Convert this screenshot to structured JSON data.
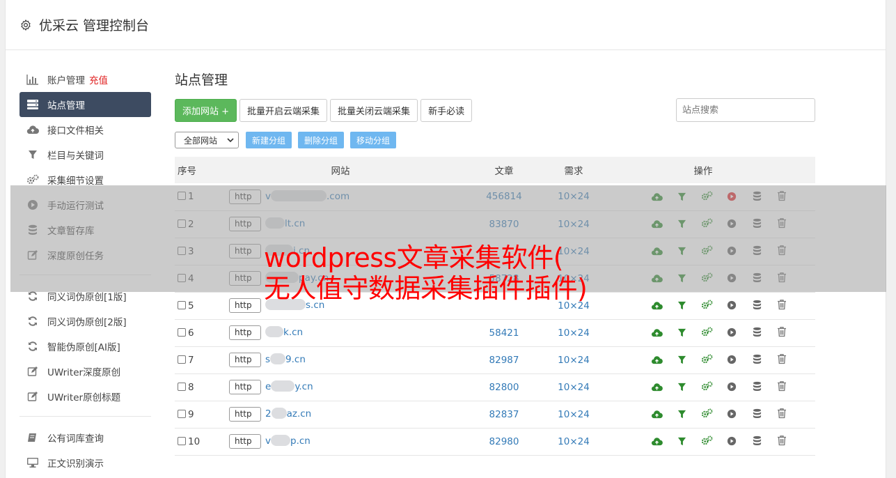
{
  "header": {
    "title": "优采云 管理控制台"
  },
  "sidebar": {
    "groups": [
      [
        {
          "label": "账户管理",
          "badge": "充值",
          "icon": "bar-chart-icon"
        },
        {
          "label": "站点管理",
          "icon": "server-icon",
          "active": true
        },
        {
          "label": "接口文件相关",
          "icon": "cloud-upload-icon"
        },
        {
          "label": "栏目与关键词",
          "icon": "filter-icon"
        },
        {
          "label": "采集细节设置",
          "icon": "gears-icon"
        },
        {
          "label": "手动运行测试",
          "icon": "play-circle-icon"
        },
        {
          "label": "文章暂存库",
          "icon": "database-icon"
        },
        {
          "label": "深度原创任务",
          "icon": "edit-icon"
        }
      ],
      [
        {
          "label": "同义词伪原创[1版]",
          "icon": "refresh-icon"
        },
        {
          "label": "同义词伪原创[2版]",
          "icon": "refresh-icon"
        },
        {
          "label": "智能伪原创[AI版]",
          "icon": "refresh-icon"
        },
        {
          "label": "UWriter深度原创",
          "icon": "edit-icon"
        },
        {
          "label": "UWriter原创标题",
          "icon": "edit-icon"
        }
      ],
      [
        {
          "label": "公有词库查询",
          "icon": "book-icon"
        },
        {
          "label": "正文识别演示",
          "icon": "monitor-icon"
        }
      ]
    ]
  },
  "main": {
    "title": "站点管理",
    "toolbar": {
      "add_label": "添加网站 +",
      "batch_open_label": "批量开启云端采集",
      "batch_close_label": "批量关闭云端采集",
      "guide_label": "新手必读",
      "search_placeholder": "站点搜索"
    },
    "filter": {
      "select_value": "全部网站",
      "new_group": "新建分组",
      "delete_group": "删除分组",
      "move_group": "移动分组"
    },
    "table": {
      "headers": [
        "序号",
        "网站",
        "文章",
        "需求",
        "操作"
      ],
      "http_label": "http",
      "rows": [
        {
          "no": "1",
          "prefix": "v",
          "suffix": ".com",
          "articles": "456814",
          "need": "10×24",
          "run_active": true
        },
        {
          "no": "2",
          "prefix": "",
          "suffix": "lt.cn",
          "articles": "83870",
          "need": "10×24"
        },
        {
          "no": "3",
          "prefix": "",
          "suffix": "i.cn",
          "articles": "",
          "need": "10×24"
        },
        {
          "no": "4",
          "prefix": "",
          "suffix": "pay.cn",
          "articles": "58728",
          "need": "10×24"
        },
        {
          "no": "5",
          "prefix": "",
          "suffix": "s.cn",
          "articles": "",
          "need": "10×24"
        },
        {
          "no": "6",
          "prefix": "",
          "suffix": "k.cn",
          "articles": "58421",
          "need": "10×24"
        },
        {
          "no": "7",
          "prefix": "s",
          "suffix": "9.cn",
          "articles": "82987",
          "need": "10×24"
        },
        {
          "no": "8",
          "prefix": "e",
          "suffix": "y.cn",
          "articles": "82800",
          "need": "10×24"
        },
        {
          "no": "9",
          "prefix": "2",
          "suffix": "az.cn",
          "articles": "82837",
          "need": "10×24"
        },
        {
          "no": "10",
          "prefix": "v",
          "suffix": "p.cn",
          "articles": "82980",
          "need": "10×24"
        }
      ]
    }
  },
  "watermark": {
    "line1": "wordpress文章采集软件(",
    "line2": "无人值守数据采集插件插件)"
  },
  "colors": {
    "accent_green": "#5cb85c",
    "active_nav": "#3d4b61",
    "link": "#337ab7",
    "watermark": "#ff0000"
  }
}
